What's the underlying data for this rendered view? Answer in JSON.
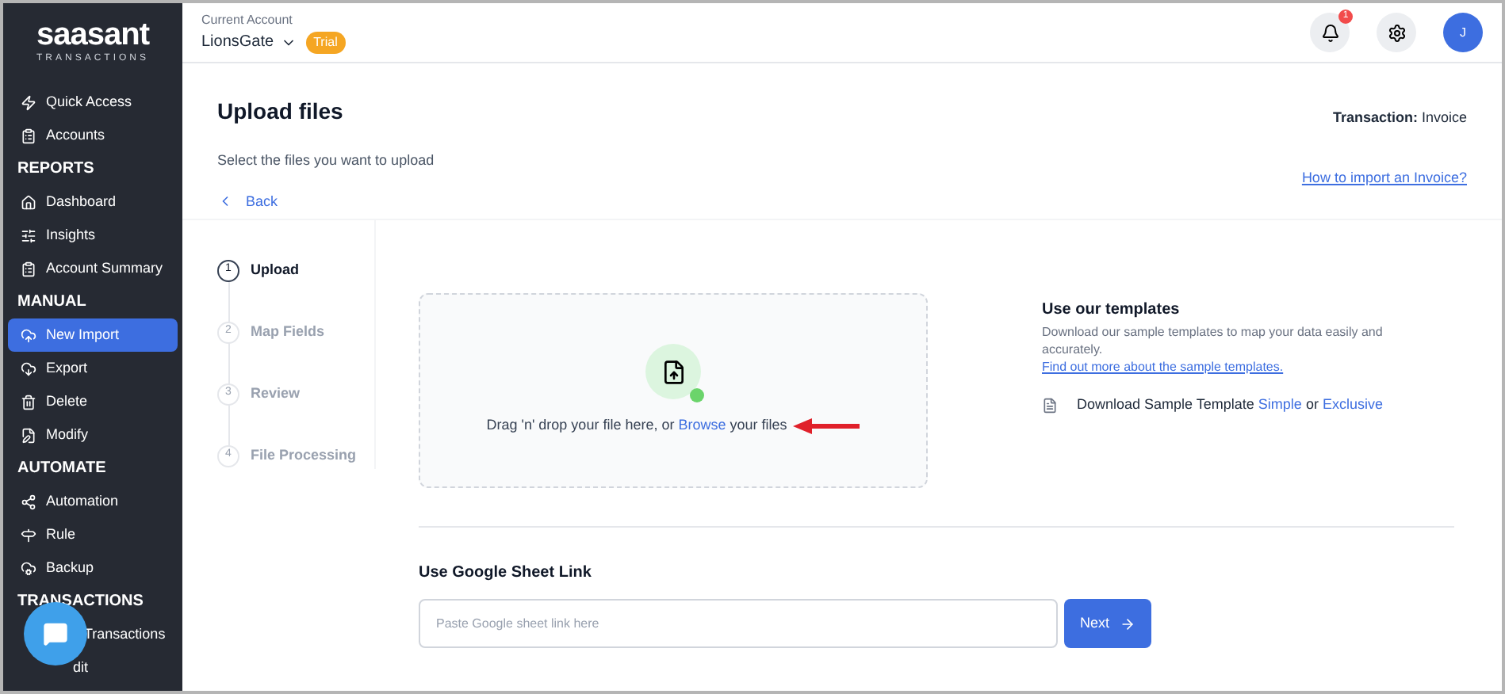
{
  "logo": {
    "name": "saasant",
    "tagline": "TRANSACTIONS"
  },
  "sidebar": {
    "items": [
      {
        "kind": "item",
        "label": "Quick Access",
        "selected": false
      },
      {
        "kind": "item",
        "label": "Accounts",
        "selected": false
      },
      {
        "kind": "section",
        "label": "REPORTS"
      },
      {
        "kind": "item",
        "label": "Dashboard",
        "selected": false
      },
      {
        "kind": "item",
        "label": "Insights",
        "selected": false
      },
      {
        "kind": "item",
        "label": "Account Summary",
        "selected": false
      },
      {
        "kind": "section",
        "label": "MANUAL"
      },
      {
        "kind": "item",
        "label": "New Import",
        "selected": true
      },
      {
        "kind": "item",
        "label": "Export",
        "selected": false
      },
      {
        "kind": "item",
        "label": "Delete",
        "selected": false
      },
      {
        "kind": "item",
        "label": "Modify",
        "selected": false
      },
      {
        "kind": "section",
        "label": "AUTOMATE"
      },
      {
        "kind": "item",
        "label": "Automation",
        "selected": false
      },
      {
        "kind": "item",
        "label": "Rule",
        "selected": false
      },
      {
        "kind": "item",
        "label": "Backup",
        "selected": false
      },
      {
        "kind": "section",
        "label": "TRANSACTIONS"
      },
      {
        "kind": "covered",
        "label": "Transactions",
        "selected": false
      },
      {
        "kind": "covered",
        "label": "dit",
        "selected": false
      }
    ]
  },
  "header": {
    "account_label": "Current Account",
    "account": "LionsGate",
    "badge": "Trial",
    "notifications": "1",
    "avatar": "J"
  },
  "page": {
    "title": "Upload files",
    "subtitle": "Select the files you want to upload",
    "back": "Back",
    "transaction_label": "Transaction:",
    "transaction": "Invoice",
    "help_link": "How to import an Invoice?"
  },
  "steps": [
    {
      "number": "1",
      "label": "Upload",
      "selected": true
    },
    {
      "number": "2",
      "label": "Map Fields",
      "selected": false
    },
    {
      "number": "3",
      "label": "Review",
      "selected": false
    },
    {
      "number": "4",
      "label": "File Processing",
      "selected": false
    }
  ],
  "dropzone": {
    "text_before": "Drag 'n' drop your file here, or",
    "link": "Browse",
    "text_after": "your files"
  },
  "templates": {
    "title": "Use our templates",
    "description": "Download our sample templates to map your data easily and accurately.",
    "link": "Find out more about the sample templates.",
    "download_label": "Download Sample Template",
    "option_1": "Simple",
    "or": "or",
    "option_2": "Exclusive"
  },
  "google_sheet": {
    "title": "Use Google Sheet Link",
    "placeholder": "Paste Google sheet link here",
    "button": "Next"
  }
}
